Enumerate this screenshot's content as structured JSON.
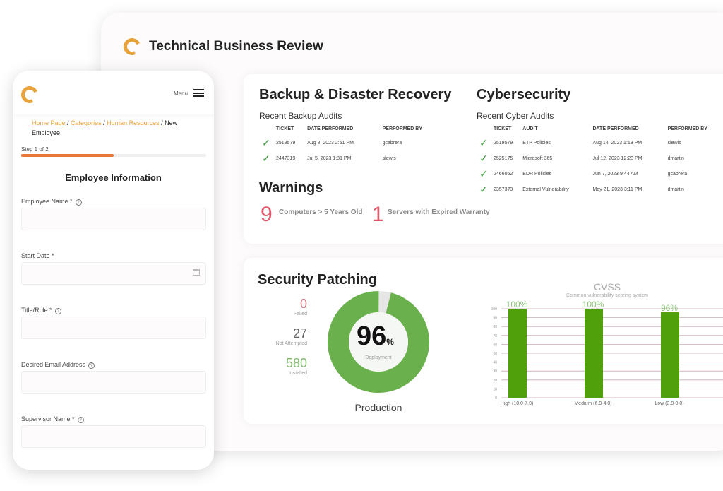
{
  "header": {
    "title": "Technical Business Review"
  },
  "backup": {
    "title": "Backup & Disaster Recovery",
    "subtitle": "Recent Backup Audits",
    "columns": [
      "TICKET",
      "DATE PERFORMED",
      "PERFORMED BY"
    ],
    "rows": [
      [
        "2519579",
        "Aug 8, 2023 2:51 PM",
        "gcabrera"
      ],
      [
        "2447319",
        "Jul 5, 2023 1:31 PM",
        "slewis"
      ]
    ]
  },
  "cyber": {
    "title": "Cybersecurity",
    "subtitle": "Recent Cyber Audits",
    "columns": [
      "TICKET",
      "AUDIT",
      "DATE PERFORMED",
      "PERFORMED BY"
    ],
    "rows": [
      [
        "2519579",
        "ETP Policies",
        "Aug 14, 2023 1:18 PM",
        "slewis"
      ],
      [
        "2525175",
        "Microsoft 365",
        "Jul 12, 2023 12:23 PM",
        "dmartin"
      ],
      [
        "2466062",
        "EDR Policies",
        "Jun 7, 2023 9:44 AM",
        "gcabrera"
      ],
      [
        "2357373",
        "External Vulnerability",
        "May 21, 2023 3:11 PM",
        "dmartin"
      ]
    ]
  },
  "warnings": {
    "title": "Warnings",
    "items": [
      {
        "count": "9",
        "label": "Computers > 5 Years Old"
      },
      {
        "count": "1",
        "label": "Servers with Expired Warranty"
      }
    ]
  },
  "patching": {
    "title": "Security Patching",
    "stats": [
      {
        "value": "0",
        "label": "Failed",
        "color": "#c9747f"
      },
      {
        "value": "27",
        "label": "Not Attempted",
        "color": "#666666"
      },
      {
        "value": "580",
        "label": "Installed",
        "color": "#7fb86a"
      }
    ],
    "percent": "96",
    "percent_sign": "%",
    "center_label": "Deployment",
    "donut_label": "Production"
  },
  "chart_data": {
    "type": "bar",
    "title": "CVSS",
    "subtitle": "Common vulnerability scoring system",
    "categories": [
      "High (10.0-7.0)",
      "Medium (6.9-4.0)",
      "Low (3.9-0.0)"
    ],
    "values": [
      100,
      100,
      96
    ],
    "data_labels": [
      "100%",
      "100%",
      "96%"
    ],
    "ylim": [
      0,
      100
    ],
    "yticks": [
      0,
      10,
      20,
      30,
      40,
      50,
      60,
      70,
      80,
      90,
      100
    ],
    "grid": true,
    "color": "#4fa00a"
  },
  "phone": {
    "menu": "Menu",
    "breadcrumb": [
      {
        "label": "Home Page"
      },
      {
        "label": "Categories"
      },
      {
        "label": "Human Resources"
      }
    ],
    "breadcrumb_current": "New Employee",
    "step": "Step 1 of 2",
    "progress": 0.5,
    "form_title": "Employee Information",
    "fields": [
      {
        "label": "Employee Name *",
        "help": true
      },
      {
        "label": "Start Date *",
        "help": false
      },
      {
        "label": "Title/Role *",
        "help": true
      },
      {
        "label": "Desired Email Address",
        "help": true
      },
      {
        "label": "Supervisor Name *",
        "help": true
      }
    ]
  },
  "colors": {
    "accent": "#e8773a",
    "link": "#e8a33d",
    "green": "#6ab04c",
    "warning": "#e0576b"
  }
}
